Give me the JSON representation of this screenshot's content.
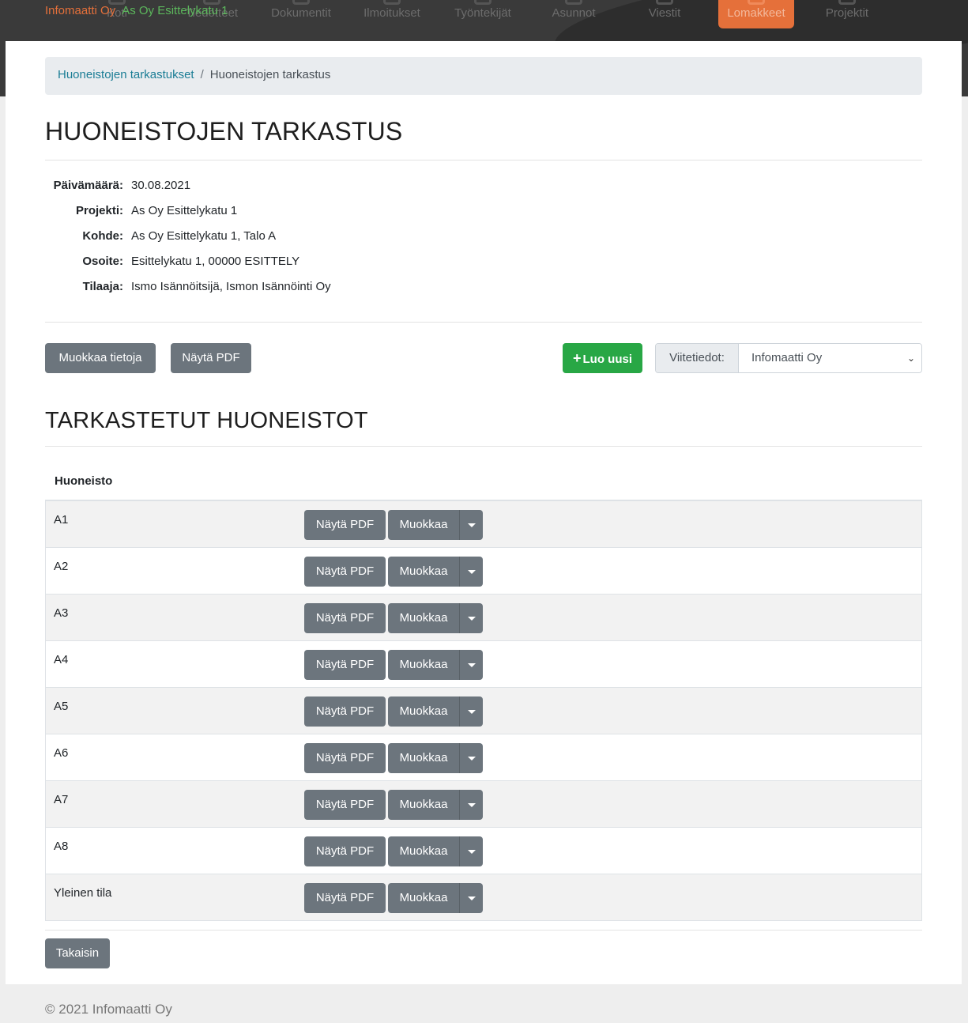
{
  "header": {
    "company": "Infomaatti Oy",
    "project": "As Oy Esittelykatu 1",
    "nav": [
      {
        "label": "Koti",
        "icon": "home-icon"
      },
      {
        "label": "Tiedotteet",
        "icon": "megaphone-icon"
      },
      {
        "label": "Dokumentit",
        "icon": "document-icon"
      },
      {
        "label": "Ilmoitukset",
        "icon": "bell-icon"
      },
      {
        "label": "Työntekijät",
        "icon": "users-icon"
      },
      {
        "label": "Asunnot",
        "icon": "building-icon"
      },
      {
        "label": "Viestit",
        "icon": "message-icon"
      },
      {
        "label": "Lomakkeet",
        "icon": "form-icon",
        "active": true
      },
      {
        "label": "Projektit",
        "icon": "project-icon"
      }
    ]
  },
  "breadcrumb": {
    "parent": "Huoneistojen tarkastukset",
    "current": "Huoneistojen tarkastus"
  },
  "page_title": "HUONEISTOJEN TARKASTUS",
  "info": {
    "date_label": "Päivämäärä:",
    "date": "30.08.2021",
    "project_label": "Projekti:",
    "project": "As Oy Esittelykatu 1",
    "target_label": "Kohde:",
    "target": "As Oy Esittelykatu 1, Talo A",
    "address_label": "Osoite:",
    "address": "Esittelykatu 1, 00000 ESITTELY",
    "client_label": "Tilaaja:",
    "client": "Ismo Isännöitsijä, Ismon Isännöinti Oy"
  },
  "actions": {
    "edit_info": "Muokkaa tietoja",
    "show_pdf": "Näytä PDF",
    "create_new": "Luo uusi",
    "reference_label": "Viitetiedot:",
    "reference_value": "Infomaatti Oy"
  },
  "section_title": "TARKASTETUT HUONEISTOT",
  "table": {
    "column": "Huoneisto",
    "pdf_label": "Näytä PDF",
    "edit_label": "Muokkaa",
    "rows": [
      "A1",
      "A2",
      "A3",
      "A4",
      "A5",
      "A6",
      "A7",
      "A8",
      "Yleinen tila"
    ]
  },
  "back": "Takaisin",
  "footer": "© 2021 Infomaatti Oy",
  "colors": {
    "accent": "#e5703a",
    "success": "#28a745",
    "secondary": "#6c757d",
    "link": "#1a7d95"
  }
}
